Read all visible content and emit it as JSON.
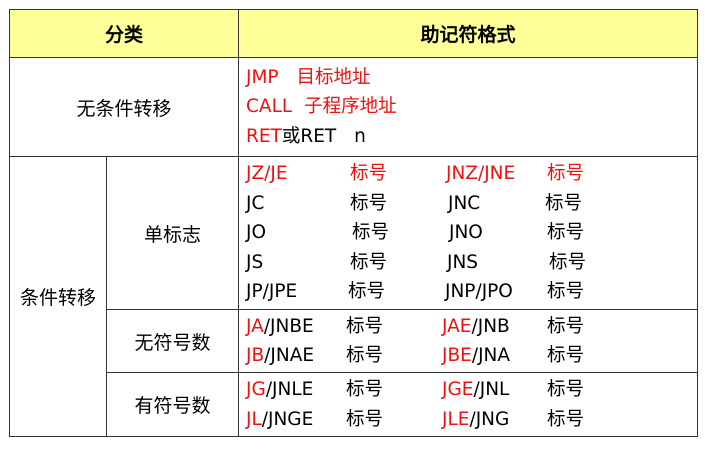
{
  "header": {
    "col1": "分类",
    "col2": "助记符格式"
  },
  "uncond": {
    "label": "无条件转移",
    "lines": [
      {
        "op": "JMP",
        "arg": "目标地址"
      },
      {
        "op": "CALL",
        "arg": "子程序地址"
      },
      {
        "op": "RET",
        "sep": "或",
        "op2": "RET",
        "arg": "n"
      }
    ]
  },
  "cond": {
    "label": "条件转移",
    "single": {
      "label": "单标志",
      "rows": [
        {
          "a": "JZ/JE",
          "at": "标号",
          "b": "JNZ/JNE",
          "bt": "标号"
        },
        {
          "a": "JC",
          "at": "标号",
          "b": "JNC",
          "bt": "标号"
        },
        {
          "a": "JO",
          "at": "标号",
          "b": "JNO",
          "bt": "标号"
        },
        {
          "a": "JS",
          "at": "标号",
          "b": "JNS",
          "bt": "标号"
        },
        {
          "a": "JP/JPE",
          "at": "标号",
          "b": "JNP/JPO",
          "bt": "标号"
        }
      ]
    },
    "unsigned": {
      "label": "无符号数",
      "rows": [
        {
          "a1": "JA",
          "a2": "/JNBE",
          "at": "标号",
          "b1": "JAE",
          "b2": "/JNB",
          "bt": "标号"
        },
        {
          "a1": "JB",
          "a2": "/JNAE",
          "at": "标号",
          "b1": "JBE",
          "b2": "/JNA",
          "bt": "标号"
        }
      ]
    },
    "signed": {
      "label": "有符号数",
      "rows": [
        {
          "a1": "JG",
          "a2": "/JNLE",
          "at": "标号",
          "b1": "JGE",
          "b2": "/JNL",
          "bt": "标号"
        },
        {
          "a1": "JL",
          "a2": "/JNGE",
          "at": "标号",
          "b1": "JLE",
          "b2": "/JNG",
          "bt": "标号"
        }
      ]
    },
    "colors": {
      "highlight": "#ee1111",
      "header_bg": "#ffff99"
    }
  }
}
